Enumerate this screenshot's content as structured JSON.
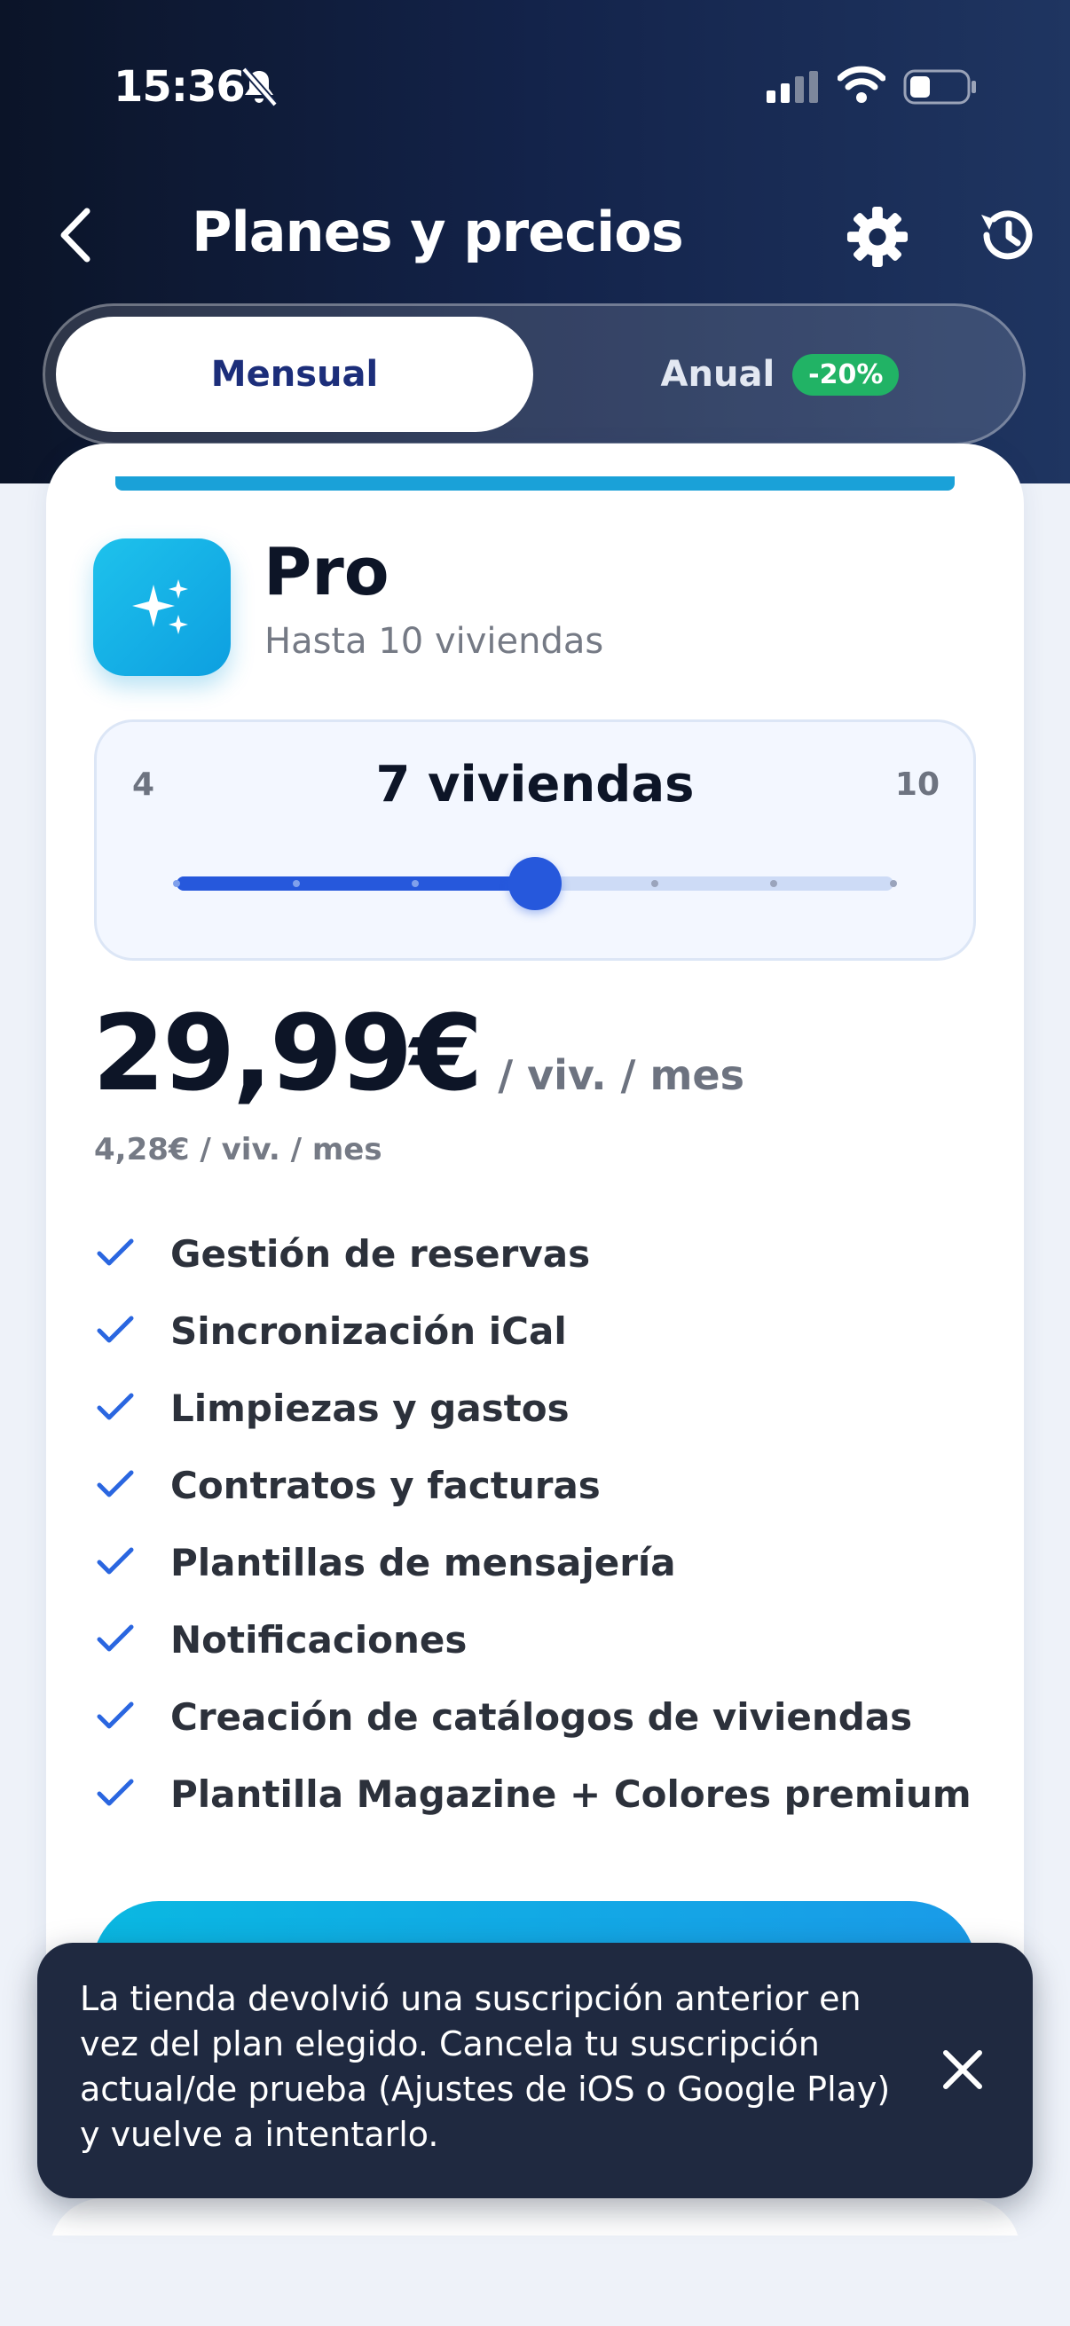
{
  "status_bar": {
    "time": "15:36"
  },
  "header": {
    "title": "Planes y precios"
  },
  "billing_toggle": {
    "monthly_label": "Mensual",
    "annual_label": "Anual",
    "annual_discount": "-20%"
  },
  "plan": {
    "name": "Pro",
    "subtitle": "Hasta 10 viviendas",
    "slider": {
      "min_label": "4",
      "max_label": "10",
      "value_label": "7 viviendas",
      "min": 4,
      "max": 10,
      "value": 7
    },
    "price": "29,99€",
    "price_unit": "/ viv. / mes",
    "price_secondary": "4,28€ / viv. / mes",
    "features": [
      "Gestión de reservas",
      "Sincronización iCal",
      "Limpiezas y gastos",
      "Contratos y facturas",
      "Plantillas de mensajería",
      "Notificaciones",
      "Creación de catálogos de viviendas",
      "Plantilla Magazine + Colores premium"
    ]
  },
  "toast": {
    "message": "La tienda devolvió una suscripción anterior en vez del plan elegido. Cancela tu suscripción actual/de prueba (Ajustes de iOS o Google Play) y vuelve a intentarlo."
  },
  "colors": {
    "accent": "#2658dc",
    "header_bg": "#13234a",
    "badge": "#21b365",
    "cta": "#0ab8e2",
    "toast_bg": "#1f2940"
  },
  "icons": {
    "back": "chevron-left-icon",
    "settings": "gear-icon",
    "history": "history-icon",
    "plan": "sparkles-icon",
    "feature": "check-icon",
    "close": "close-icon"
  }
}
